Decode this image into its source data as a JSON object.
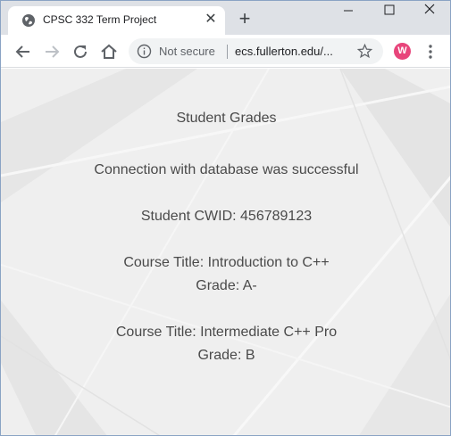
{
  "browser": {
    "tab_title": "CPSC 332 Term Project",
    "tab_close_glyph": "✕",
    "new_tab_glyph": "+",
    "security_label": "Not secure",
    "url": "ecs.fullerton.edu/...",
    "profile_initial": "W",
    "profile_color": "#e8457b"
  },
  "page": {
    "heading": "Student Grades",
    "connection_status": "Connection with database was successful",
    "student_cwid": "Student CWID: 456789123",
    "courses": [
      {
        "title": "Course Title: Introduction to C++",
        "grade": "Grade: A-"
      },
      {
        "title": "Course Title: Intermediate C++ Pro",
        "grade": "Grade: B"
      }
    ]
  }
}
